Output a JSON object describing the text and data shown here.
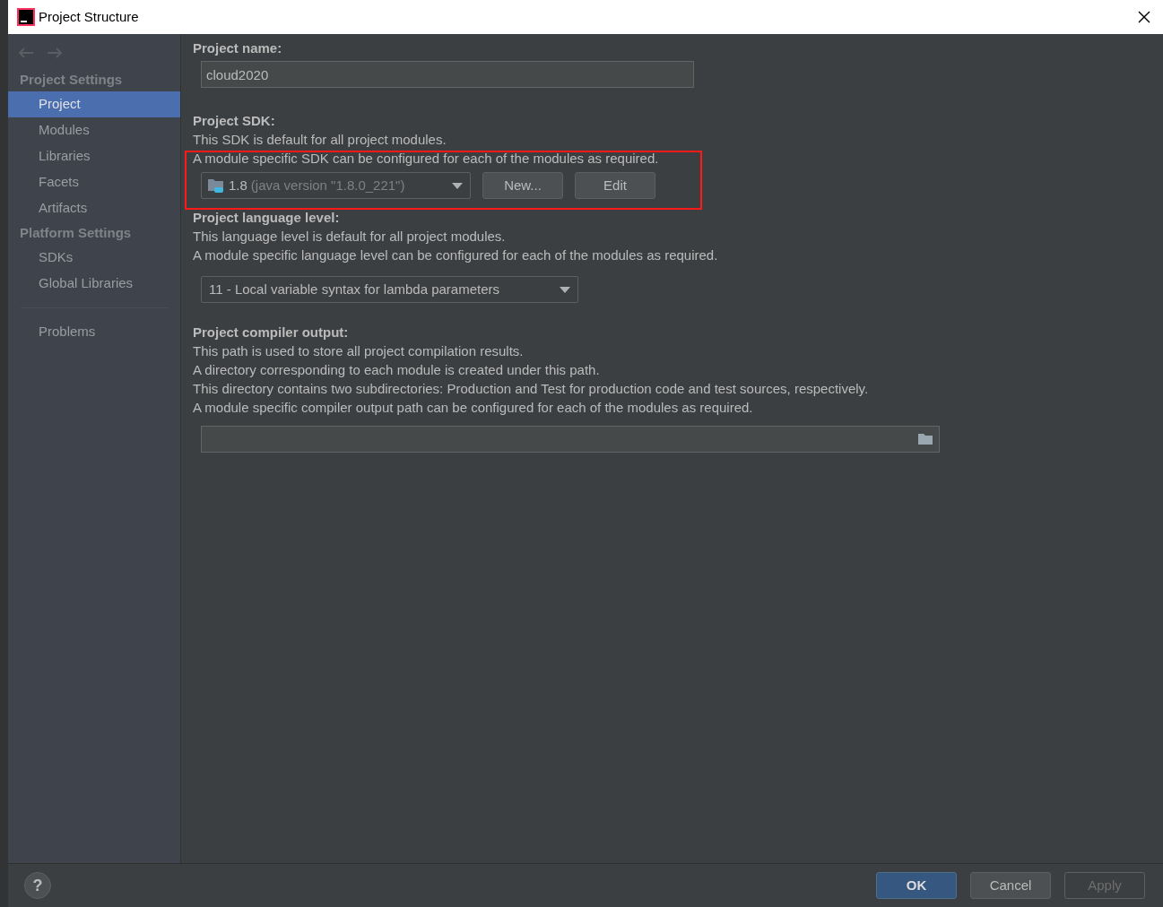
{
  "window": {
    "title": "Project Structure"
  },
  "sidebar": {
    "sections": [
      {
        "heading": "Project Settings",
        "items": [
          {
            "label": "Project",
            "selected": true
          },
          {
            "label": "Modules",
            "selected": false
          },
          {
            "label": "Libraries",
            "selected": false
          },
          {
            "label": "Facets",
            "selected": false
          },
          {
            "label": "Artifacts",
            "selected": false
          }
        ]
      },
      {
        "heading": "Platform Settings",
        "items": [
          {
            "label": "SDKs",
            "selected": false
          },
          {
            "label": "Global Libraries",
            "selected": false
          }
        ]
      }
    ],
    "bottom_items": [
      {
        "label": "Problems",
        "selected": false
      }
    ]
  },
  "project_name": {
    "label": "Project name:",
    "value": "cloud2020"
  },
  "project_sdk": {
    "label": "Project SDK:",
    "descriptions": [
      "This SDK is default for all project modules.",
      "A module specific SDK can be configured for each of the modules as required."
    ],
    "version": "1.8",
    "detail": "(java version \"1.8.0_221\")",
    "buttons": [
      "New...",
      "Edit"
    ]
  },
  "language_level": {
    "label": "Project language level:",
    "descriptions": [
      "This language level is default for all project modules.",
      "A module specific language level can be configured for each of the modules as required."
    ],
    "value": "11 - Local variable syntax for lambda parameters"
  },
  "compiler_output": {
    "label": "Project compiler output:",
    "descriptions": [
      "This path is used to store all project compilation results.",
      "A directory corresponding to each module is created under this path.",
      "This directory contains two subdirectories: Production and Test for production code and test sources, respectively.",
      "A module specific compiler output path can be configured for each of the modules as required."
    ]
  },
  "footer": {
    "help": "?",
    "buttons": [
      {
        "label": "OK",
        "kind": "primary",
        "disabled": false
      },
      {
        "label": "Cancel",
        "kind": "normal",
        "disabled": false
      },
      {
        "label": "Apply",
        "kind": "normal",
        "disabled": true
      }
    ]
  }
}
